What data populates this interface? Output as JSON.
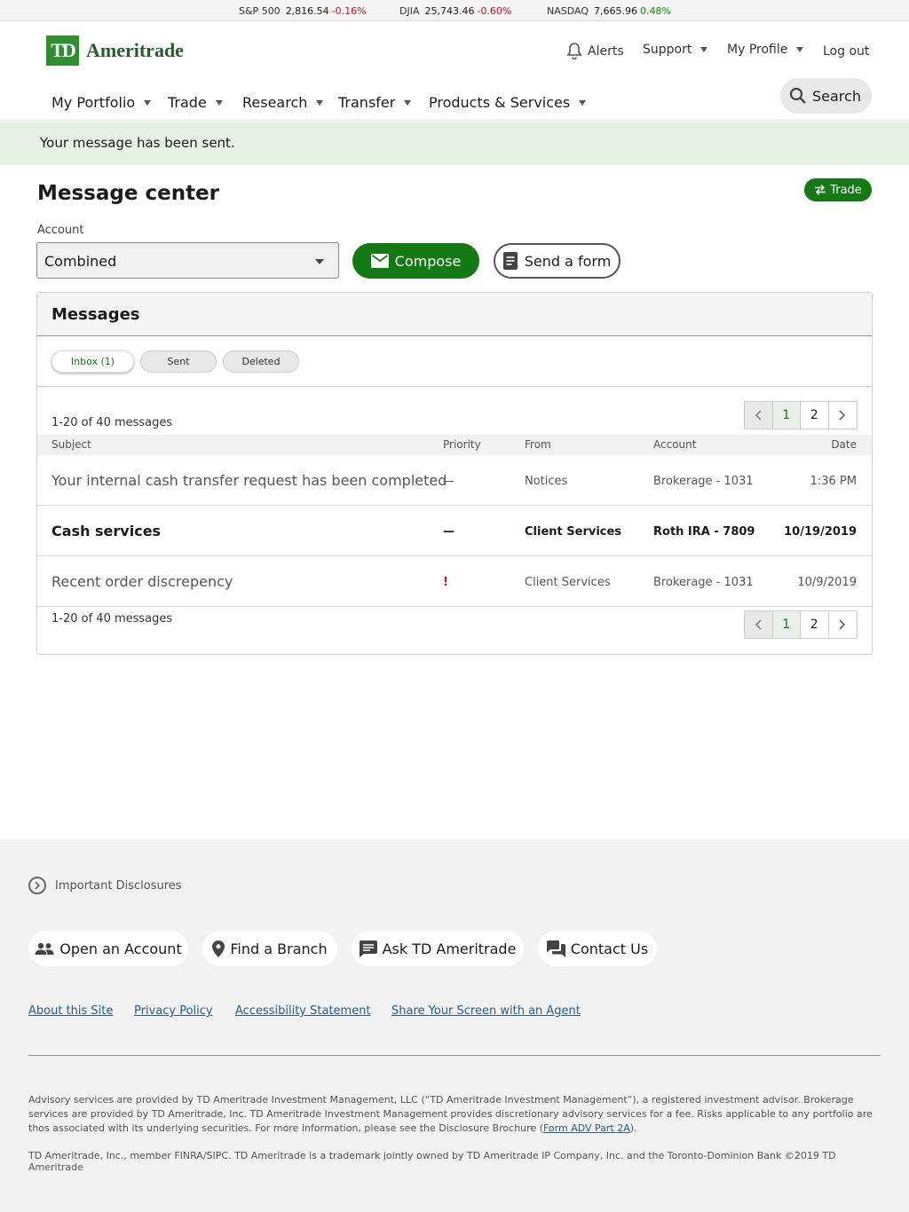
{
  "ticker": [
    {
      "name": "S&P 500",
      "value": "2,816.54",
      "change": "-0.16%",
      "dir": "neg"
    },
    {
      "name": "DJIA",
      "value": "25,743.46",
      "change": "-0.60%",
      "dir": "neg"
    },
    {
      "name": "NASDAQ",
      "value": "7,665.96",
      "change": "0.48%",
      "dir": "pos"
    }
  ],
  "brand": {
    "logo_mark": "TD",
    "name": "Ameritrade"
  },
  "utility_nav": {
    "alerts": "Alerts",
    "support": "Support",
    "profile": "My Profile",
    "logout": "Log out"
  },
  "main_nav": [
    "My Portfolio",
    "Trade",
    "Research",
    "Transfer",
    "Products & Services"
  ],
  "search": {
    "label": "Search"
  },
  "banner": {
    "message": "Your message has been sent."
  },
  "page": {
    "title": "Message center",
    "trade_label": "Trade",
    "account_label": "Account",
    "account_selected": "Combined",
    "compose_label": "Compose",
    "send_form_label": "Send a form"
  },
  "messages": {
    "title": "Messages",
    "tabs": [
      "Inbox (1)",
      "Sent",
      "Deleted"
    ],
    "count_text": "1-20 of 40  messages",
    "pages": [
      "1",
      "2"
    ],
    "columns": [
      "Subject",
      "Priority",
      "From",
      "Account",
      "Date"
    ],
    "rows": [
      {
        "subject": "Your internal cash transfer request has been completed",
        "priority": "—",
        "from": "Notices",
        "account": "Brokerage - 1031",
        "date": "1:36 PM",
        "unread": false
      },
      {
        "subject": "Cash services",
        "priority": "—",
        "from": "Client Services",
        "account": "Roth IRA - 7809",
        "date": "10/19/2019",
        "unread": true
      },
      {
        "subject": "Recent order discrepency",
        "priority": "!",
        "from": "Client Services",
        "account": "Brokerage - 1031",
        "date": "10/9/2019",
        "unread": false
      }
    ]
  },
  "footer": {
    "disclosures": "Important Disclosures",
    "buttons": [
      "Open an Account",
      "Find a Branch",
      "Ask TD Ameritrade",
      "Contact Us"
    ],
    "links": [
      "About this Site",
      "Privacy Policy",
      "Accessibility Statement",
      "Share Your Screen with an Agent"
    ],
    "legal_text": "Advisory services are provided by TD Ameritrade Investment Management, LLC (“TD Ameritrade Investment Management”), a registered investment advisor. Brokerage services are provided by TD Ameritrade, Inc. TD Ameritrade Investment Management provides discretionary advisory services for a fee. Risks applicable to any portfolio are thos associated with its underlying securities. For more information, please see the Disclosure Brochure (",
    "legal_link": "Form ADV Part 2A",
    "legal_end": ").",
    "legal_text2": "TD  Ameritrade, Inc., member FINRA/SIPC. TD Ameritrade is a trademark jointly owned by TD Ameritrade IP Company, Inc. and the Toronto-Dominion Bank ©2019 TD Ameritrade"
  },
  "colors": {
    "brand_green": "#137a13",
    "negative": "#c8102e",
    "positive": "#1a8a1a",
    "banner_bg": "#e4f1e4"
  }
}
